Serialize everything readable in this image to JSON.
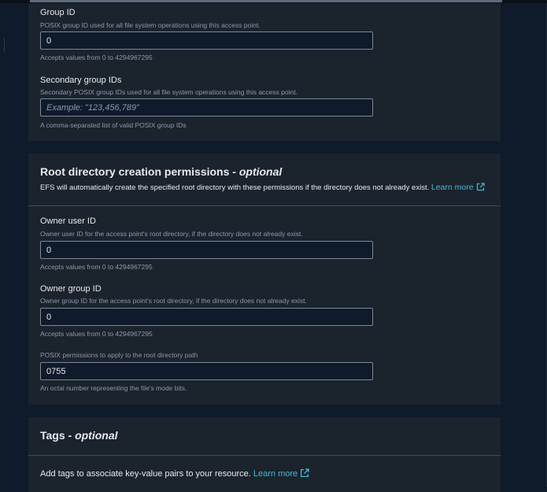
{
  "access_point": {
    "group_id": {
      "label": "Group ID",
      "description": "POSIX group ID used for all file system operations using this access point.",
      "value": "0",
      "hint": "Accepts values from 0 to 4294967295"
    },
    "secondary_group_ids": {
      "label": "Secondary group IDs",
      "description": "Secondary POSIX group IDs used for all file system operations using this access point.",
      "value": "",
      "placeholder": "Example: \"123,456,789\"",
      "hint": "A comma-separated list of valid POSIX group IDs"
    }
  },
  "root_permissions": {
    "title": "Root directory creation permissions - ",
    "title_optional": "optional",
    "description": "EFS will automatically create the specified root directory with these permissions if the directory does not already exist.",
    "learn_more": "Learn more",
    "owner_user_id": {
      "label": "Owner user ID",
      "description": "Owner user ID for the access point's root directory, if the directory does not already exist.",
      "value": "0",
      "hint": "Accepts values from 0 to 4294967295"
    },
    "owner_group_id": {
      "label": "Owner group ID",
      "description": "Owner group ID for the access point's root directory, if the directory does not already exist.",
      "value": "0",
      "hint": "Accepts values from 0 to 4294967295"
    },
    "posix_permissions": {
      "label": "POSIX permissions to apply to the root directory path",
      "value": "0755",
      "hint": "An octal number representing the file's mode bits."
    }
  },
  "tags": {
    "title": "Tags - ",
    "title_optional": "optional",
    "description": "Add tags to associate key-value pairs to your resource.",
    "learn_more": "Learn more"
  },
  "colors": {
    "background": "#0f1b2a",
    "card": "#1b232d",
    "link": "#44b9d6",
    "input_border": "#7d8998"
  }
}
